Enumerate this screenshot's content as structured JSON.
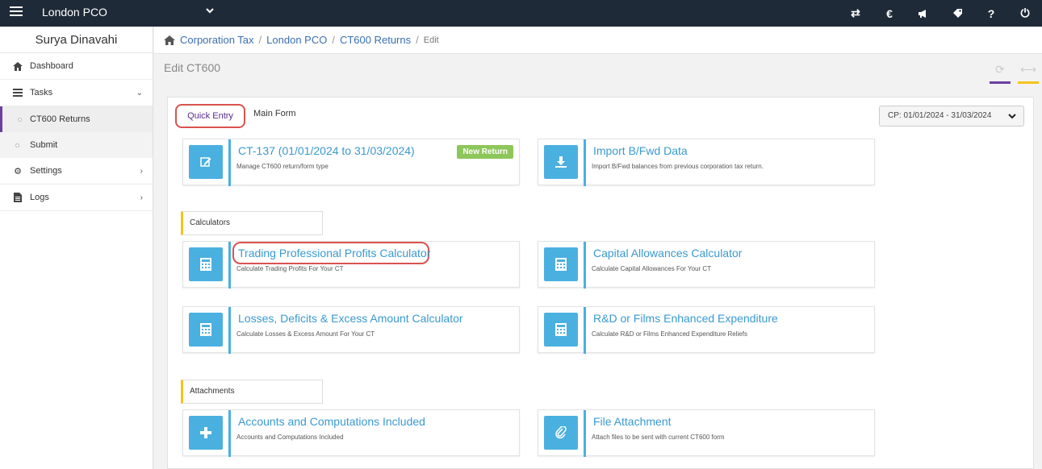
{
  "topbar": {
    "org_name": "London PCO",
    "icons": [
      "transfer-icon",
      "euro-icon",
      "megaphone-icon",
      "tag-icon",
      "help-icon",
      "power-icon"
    ]
  },
  "sidebar": {
    "user_name": "Surya Dinavahi",
    "items": [
      {
        "label": "Dashboard",
        "icon": "home-icon"
      },
      {
        "label": "Tasks",
        "icon": "tasks-icon"
      },
      {
        "label": "CT600 Returns"
      },
      {
        "label": "Submit"
      },
      {
        "label": "Settings",
        "icon": "gear-icon"
      },
      {
        "label": "Logs",
        "icon": "file-icon"
      }
    ]
  },
  "breadcrumb": {
    "items": [
      "Corporation Tax",
      "London PCO",
      "CT600 Returns"
    ],
    "current": "Edit"
  },
  "page": {
    "title": "Edit CT600"
  },
  "tabs": {
    "quick_entry": "Quick Entry",
    "main_form": "Main Form"
  },
  "period_select": {
    "value": "CP: 01/01/2024 - 31/03/2024"
  },
  "cards": [
    {
      "title": "CT-137 (01/01/2024 to 31/03/2024)",
      "subtitle": "Manage CT600 return/form type",
      "badge": "New Return",
      "icon": "edit-icon"
    },
    {
      "title": "Import B/Fwd Data",
      "subtitle": "Import B/Fwd balances from previous corporation tax return.",
      "icon": "download-icon"
    },
    {
      "title": "Trading Professional Profits Calculator",
      "subtitle": "Calculate Trading Profits For Your CT",
      "icon": "calculator-icon"
    },
    {
      "title": "Capital Allowances Calculator",
      "subtitle": "Calculate Capital Allowances For Your CT",
      "icon": "calculator-icon"
    },
    {
      "title": "Losses, Deficits & Excess Amount Calculator",
      "subtitle": "Calculate Losses & Excess Amount For Your CT",
      "icon": "calculator-icon"
    },
    {
      "title": "R&D or Films Enhanced Expenditure",
      "subtitle": "Calculate R&D or Films Enhanced Expenditure Reliefs",
      "icon": "calculator-icon"
    },
    {
      "title": "Accounts and Computations Included",
      "subtitle": "Accounts and Computations Included",
      "icon": "plus-icon"
    },
    {
      "title": "File Attachment",
      "subtitle": "Attach files to be sent with current CT600 form",
      "icon": "paperclip-icon"
    }
  ],
  "sections": {
    "calculators": "Calculators",
    "attachments": "Attachments"
  },
  "colors": {
    "topbar": "#1f2a38",
    "accent_blue": "#4ab0e0",
    "purple": "#6a3fa0",
    "yellow": "#f5c518",
    "badge_green": "#8dc65a",
    "highlight_red": "#d9534f"
  }
}
